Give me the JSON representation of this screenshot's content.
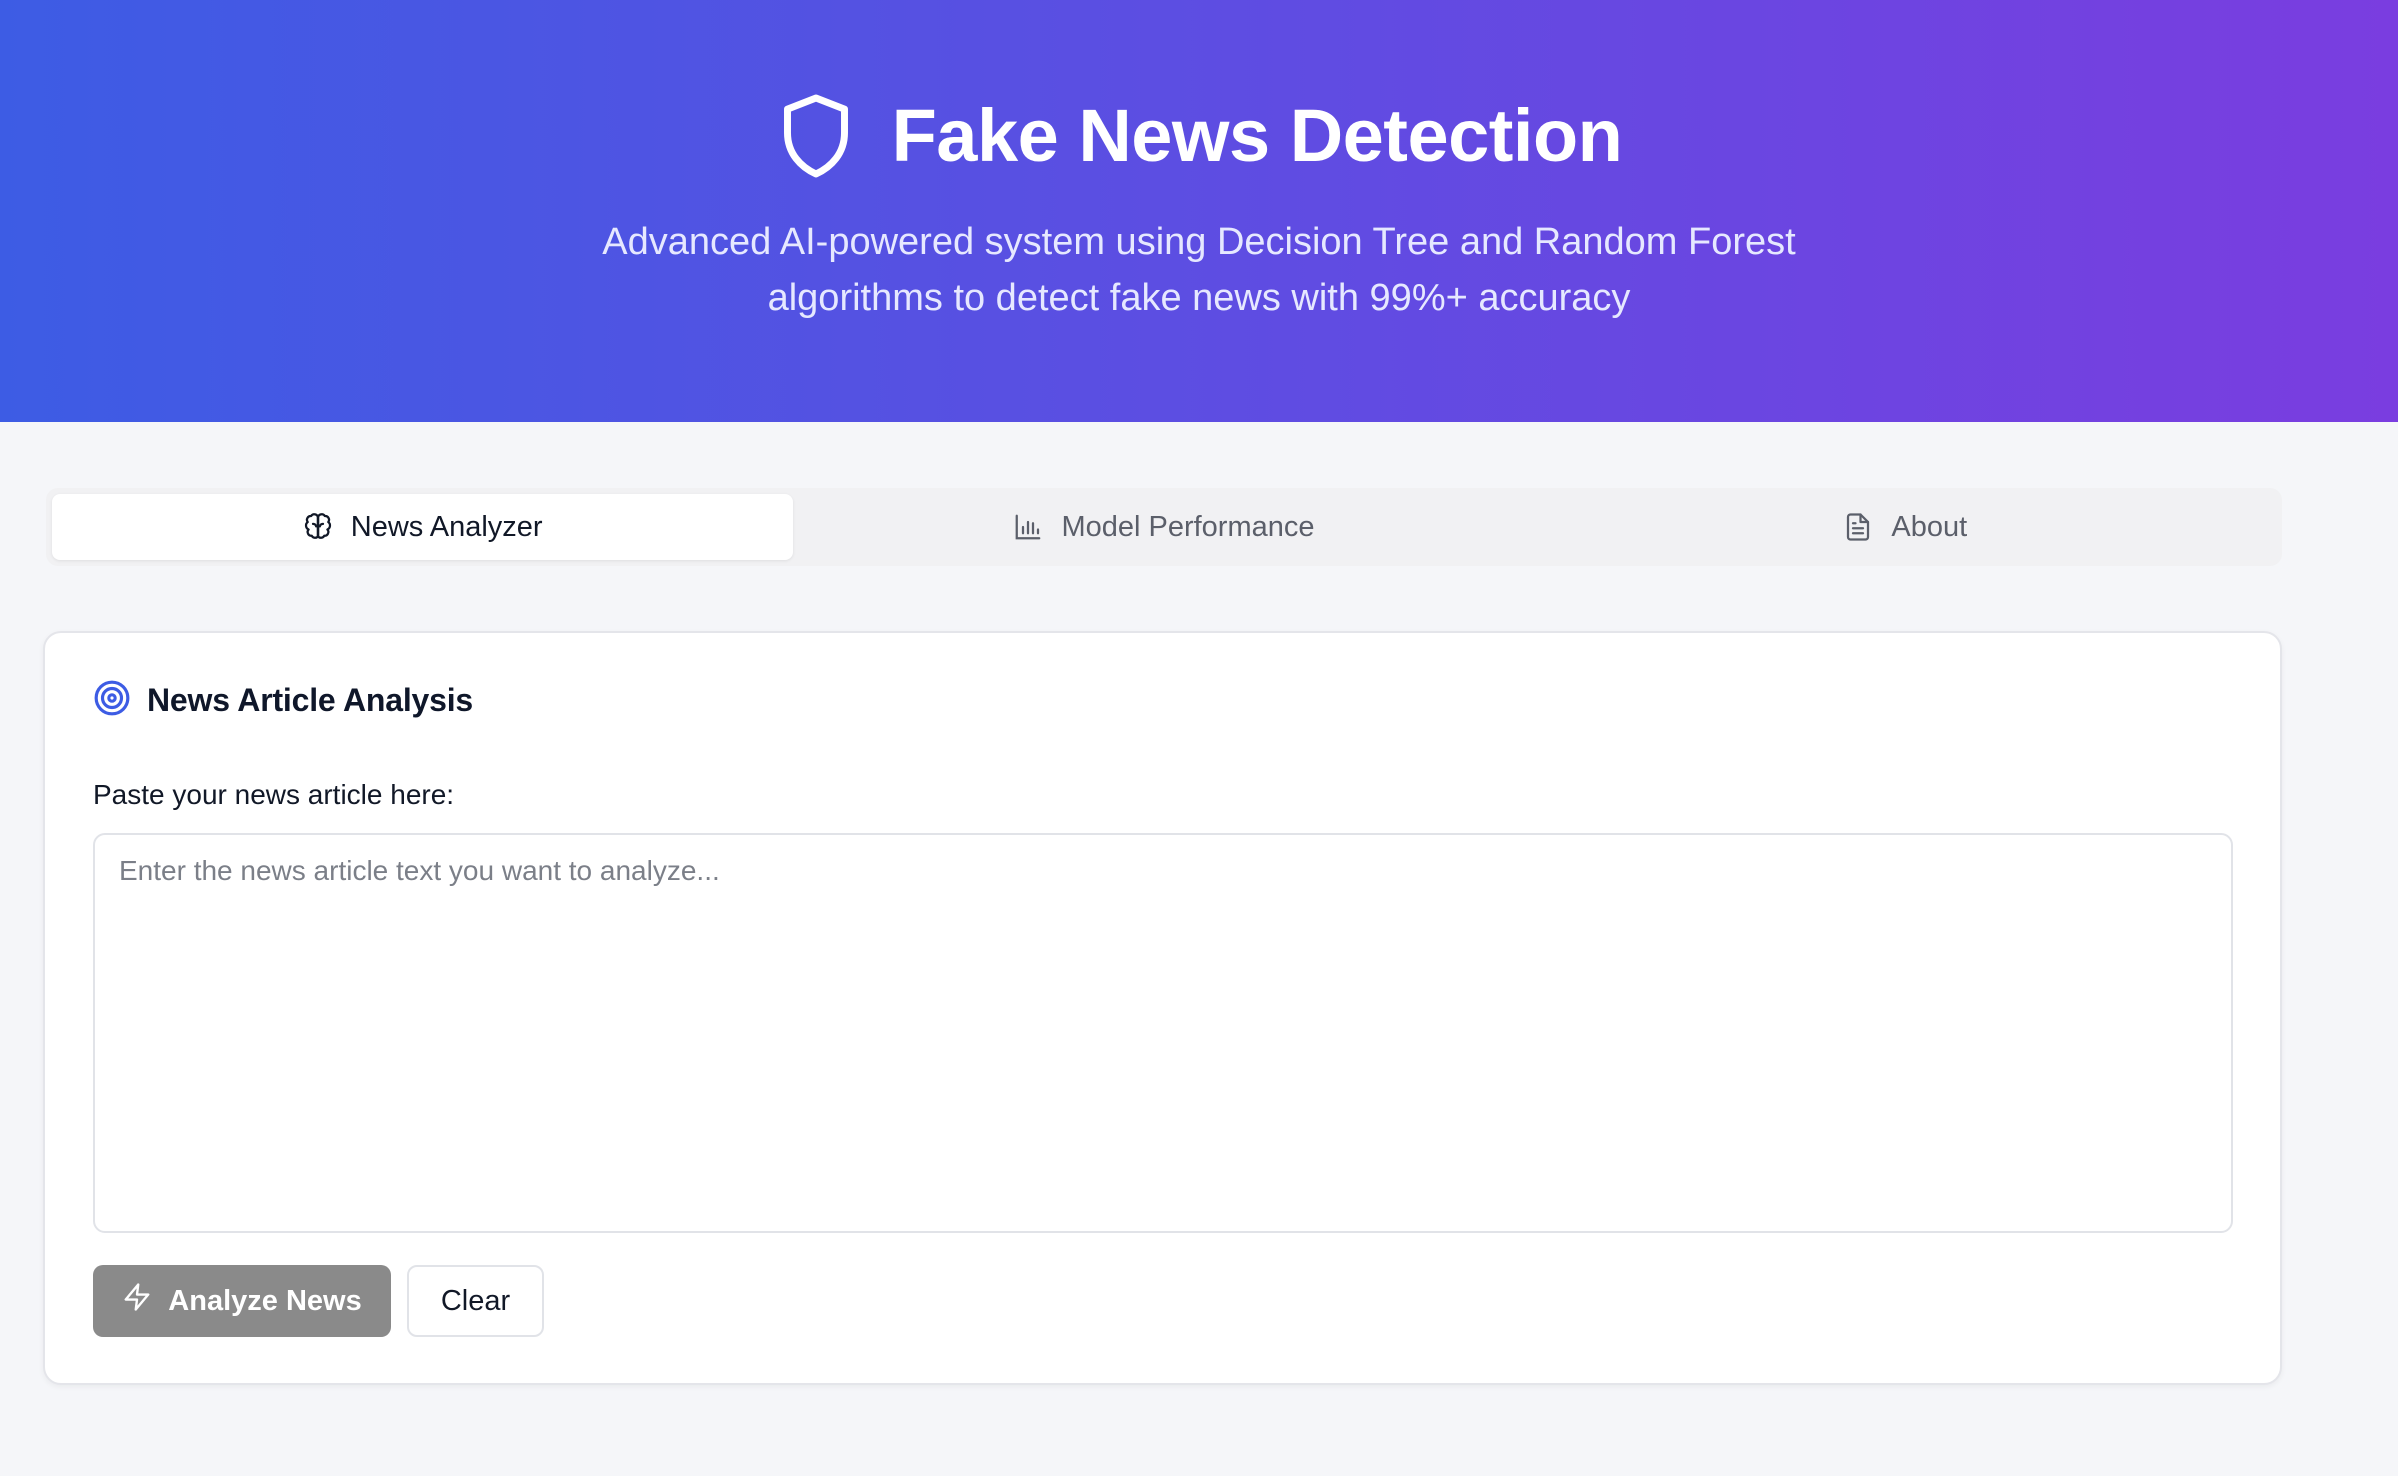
{
  "header": {
    "icon": "shield-icon",
    "title": "Fake News Detection",
    "subtitle_line1": "Advanced AI-powered system using Decision Tree and Random Forest",
    "subtitle_line2": "algorithms to detect fake news with 99%+ accuracy",
    "gradient_start": "#3d5ce4",
    "gradient_end": "#7a3de0"
  },
  "tabs": [
    {
      "label": "News Analyzer",
      "icon": "brain-icon",
      "active": true
    },
    {
      "label": "Model Performance",
      "icon": "bar-chart-icon",
      "active": false
    },
    {
      "label": "About",
      "icon": "document-icon",
      "active": false
    }
  ],
  "analysis_card": {
    "icon": "target-icon",
    "icon_color": "#3d5ce4",
    "title": "News Article Analysis",
    "field_label": "Paste your news article here:",
    "textarea_value": "",
    "textarea_placeholder": "Enter the news article text you want to analyze...",
    "analyze_button": {
      "label": "Analyze News",
      "icon": "lightning-icon",
      "disabled": true
    },
    "clear_button": {
      "label": "Clear"
    }
  }
}
